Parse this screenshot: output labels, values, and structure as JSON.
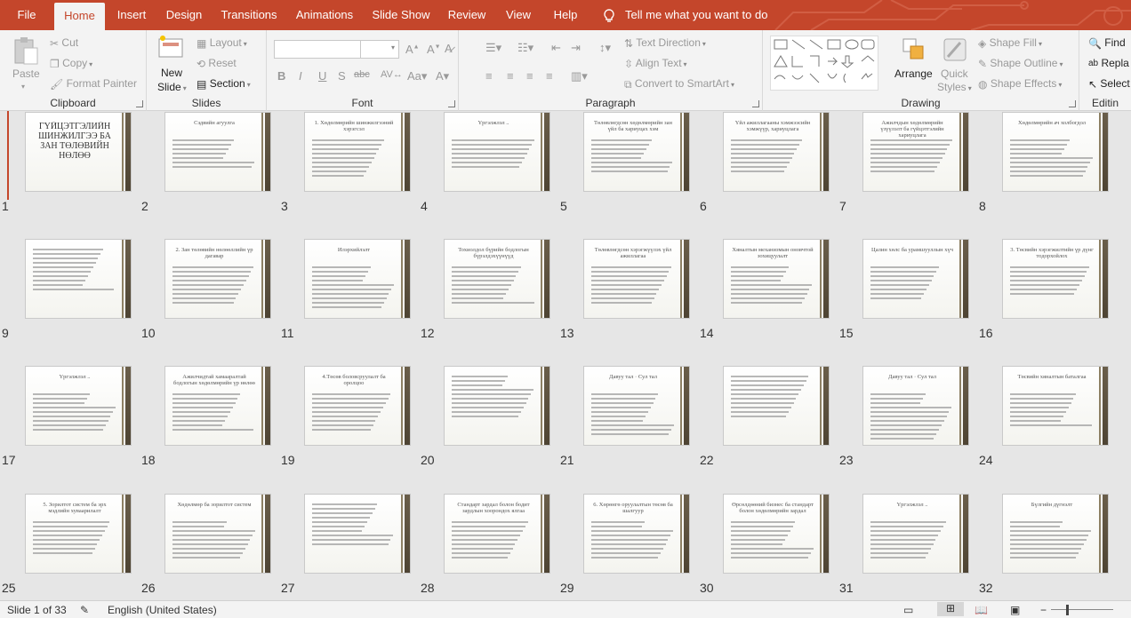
{
  "tabs": [
    "File",
    "Home",
    "Insert",
    "Design",
    "Transitions",
    "Animations",
    "Slide Show",
    "Review",
    "View",
    "Help"
  ],
  "tell_me": "Tell me what you want to do",
  "ribbon": {
    "clipboard": {
      "label": "Clipboard",
      "paste": "Paste",
      "cut": "Cut",
      "copy": "Copy",
      "format_painter": "Format Painter"
    },
    "slides": {
      "label": "Slides",
      "new_slide_1": "New",
      "new_slide_2": "Slide",
      "layout": "Layout",
      "reset": "Reset",
      "section": "Section"
    },
    "font": {
      "label": "Font"
    },
    "paragraph": {
      "label": "Paragraph",
      "text_direction": "Text Direction",
      "align_text": "Align Text",
      "convert_smartart": "Convert to SmartArt"
    },
    "drawing": {
      "label": "Drawing",
      "arrange": "Arrange",
      "quick_styles_1": "Quick",
      "quick_styles_2": "Styles",
      "shape_fill": "Shape Fill",
      "shape_outline": "Shape Outline",
      "shape_effects": "Shape Effects"
    },
    "editing": {
      "label": "Editin",
      "find": "Find",
      "replace": "Repla",
      "select": "Select"
    }
  },
  "slides": [
    {
      "n": "1",
      "title": "ГҮЙЦЭТГЭЛИЙН ШИНЖИЛГЭЭ БА ЗАН ТӨЛӨВИЙН НӨЛӨӨ",
      "big": true,
      "lines": 0
    },
    {
      "n": "2",
      "title": "Сэдвийн агуулга",
      "lines": 7
    },
    {
      "n": "3",
      "title": "1. Хөдөлмөрийн шинжилгээний хэрэгсэл",
      "lines": 9
    },
    {
      "n": "4",
      "title": "Үргэлжлэл ..",
      "lines": 7
    },
    {
      "n": "5",
      "title": "Төлөвлөгдсөн хөдөлмөрийн зан үйл ба хариуцах хэм",
      "lines": 8
    },
    {
      "n": "6",
      "title": "Үйл ажиллагааны хэмжээсийн хэмжүүр, хариуцлага",
      "lines": 8
    },
    {
      "n": "7",
      "title": "Ажилчдын хөдөлмөрийн үзүүлэлт ба гүйцэтгэлийн хариуцлага",
      "lines": 8
    },
    {
      "n": "8",
      "title": "Хөдөлмөрийн ач холбогдол",
      "lines": 9
    },
    {
      "n": "9",
      "title": "",
      "lines": 10
    },
    {
      "n": "10",
      "title": "2. Зан төлөвийн нөлөөллийн үр дагавар",
      "lines": 9
    },
    {
      "n": "11",
      "title": "Илэрхийлэлт",
      "lines": 10
    },
    {
      "n": "12",
      "title": "Тохиолдол бүрийн бодлогын бүрэлдэхүүнүүд",
      "lines": 9
    },
    {
      "n": "13",
      "title": "Төлөвлөгдсөн хэрэгжүүлэх үйл ажиллагаа",
      "lines": 9
    },
    {
      "n": "14",
      "title": "Хяналтын механизмын оновчтой зохицуулалт",
      "lines": 9
    },
    {
      "n": "15",
      "title": "Цалин хөлс ба урамшууллын хүч",
      "lines": 8
    },
    {
      "n": "16",
      "title": "3. Төсвийн хэрэгжилтийн үр дүнг тодорхойлох",
      "lines": 7
    },
    {
      "n": "17",
      "title": "Үргэлжлэл ..",
      "lines": 9
    },
    {
      "n": "18",
      "title": "Ажилчидтай хамааралтай бодлогын хөдөлмөрийн үр нөлөө",
      "lines": 9
    },
    {
      "n": "19",
      "title": "4.Төсөв боловсруулалт ба оролцоо",
      "lines": 9
    },
    {
      "n": "20",
      "title": "",
      "lines": 10
    },
    {
      "n": "21",
      "title": "Давуу тал · Сул тал",
      "lines": 10
    },
    {
      "n": "22",
      "title": "",
      "lines": 10
    },
    {
      "n": "23",
      "title": "Давуу тал · Сул тал",
      "lines": 11
    },
    {
      "n": "24",
      "title": "Төсвийн хяналтын баталгаа",
      "lines": 8
    },
    {
      "n": "25",
      "title": "5. Зорилтот систем ба эрх мэдлийн хуваарилалт",
      "lines": 8
    },
    {
      "n": "26",
      "title": "Хөдөлмөр ба зорилтот систем",
      "lines": 9
    },
    {
      "n": "27",
      "title": "",
      "lines": 10
    },
    {
      "n": "28",
      "title": "Стандарт зардал болон бодит зардлын хоорондох ялгаа",
      "lines": 9
    },
    {
      "n": "29",
      "title": "6. Хөрөнгө оруулалтын төсөв ба шалгуур",
      "lines": 9
    },
    {
      "n": "30",
      "title": "Өрсөлдөөний бизнес ба стандарт болон хөдөлмөрийн зардал",
      "lines": 9
    },
    {
      "n": "31",
      "title": "Үргэлжлэл ..",
      "lines": 9
    },
    {
      "n": "32",
      "title": "Бүлгийн дүгнэлт",
      "lines": 9
    }
  ],
  "status": {
    "slide_of": "Slide 1 of 33",
    "language": "English (United States)"
  }
}
